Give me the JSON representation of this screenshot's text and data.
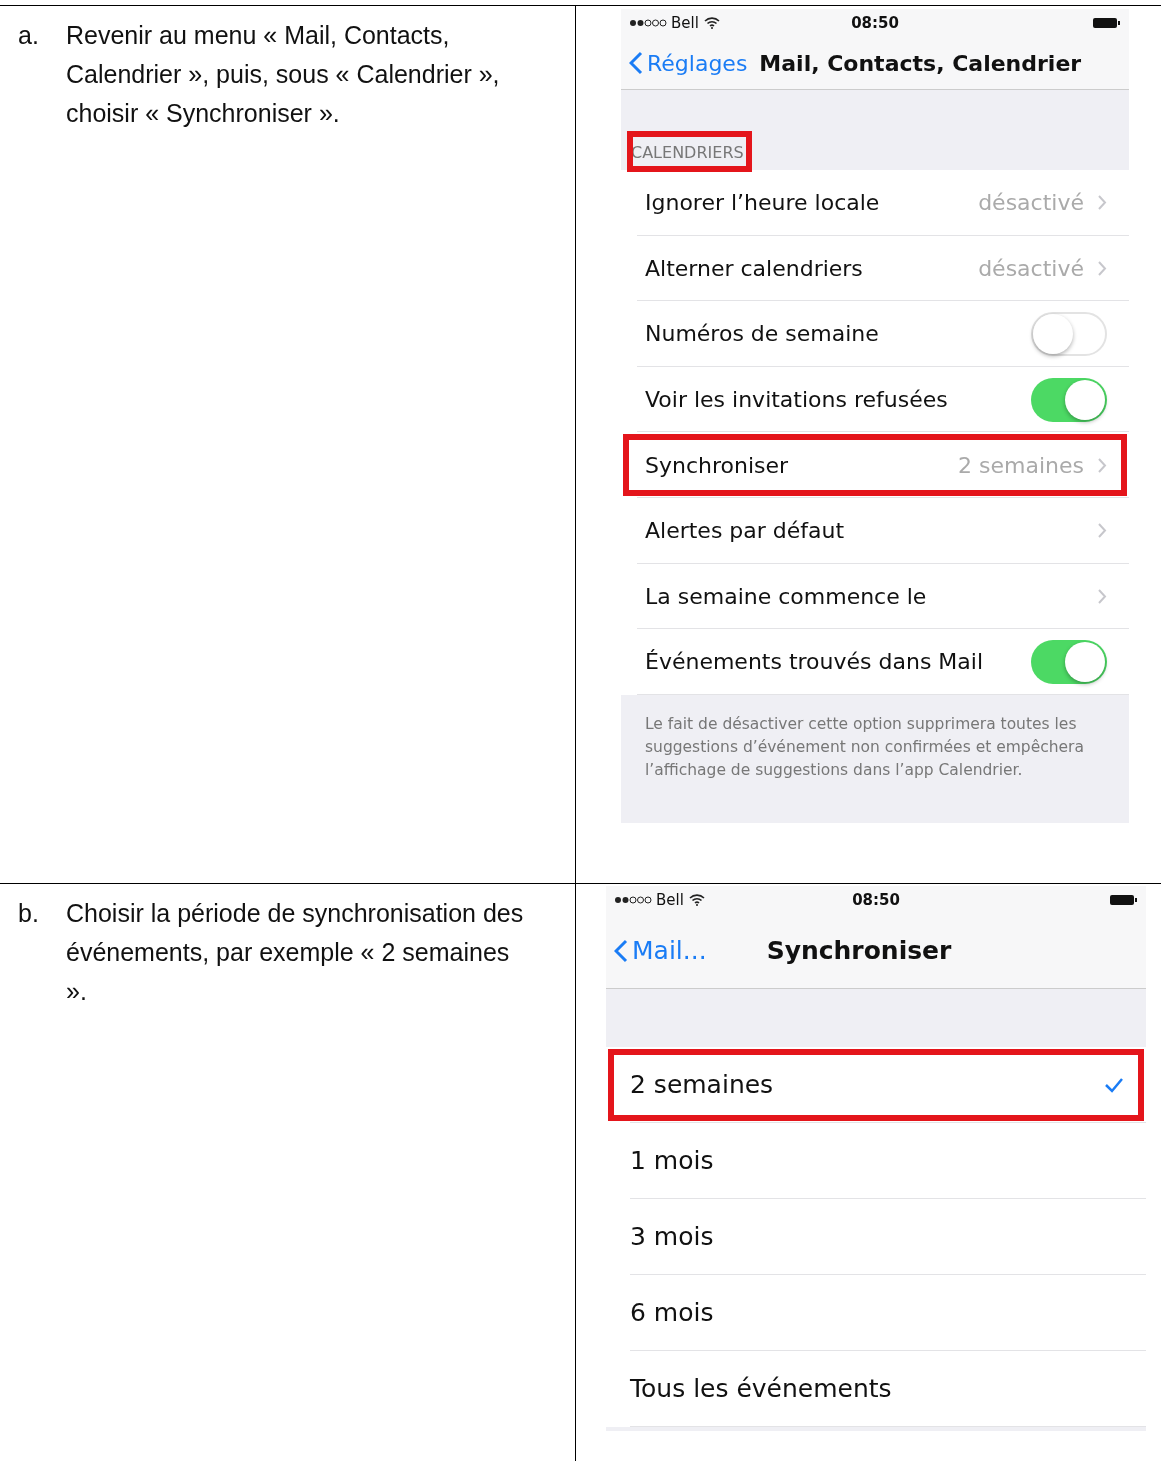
{
  "steps": [
    {
      "marker": "a.",
      "text": "Revenir au menu « Mail, Contacts, Calendrier », puis, sous « Calendrier », choisir « Synchroniser ».",
      "phone": {
        "carrier": "Bell",
        "time": "08:50",
        "back": "Réglages",
        "title": "Mail, Contacts, Calendrier",
        "section": {
          "label": "CALENDRIERS",
          "highlighted": true
        },
        "rows": [
          {
            "kind": "value",
            "label": "Ignorer l’heure locale",
            "value": "désactivé",
            "highlighted": false
          },
          {
            "kind": "value",
            "label": "Alterner calendriers",
            "value": "désactivé",
            "highlighted": false
          },
          {
            "kind": "toggle",
            "label": "Numéros de semaine",
            "on": false,
            "highlighted": false
          },
          {
            "kind": "toggle",
            "label": "Voir les invitations refusées",
            "on": true,
            "highlighted": false
          },
          {
            "kind": "value",
            "label": "Synchroniser",
            "value": "2 semaines",
            "highlighted": true
          },
          {
            "kind": "link",
            "label": "Alertes par défaut",
            "highlighted": false
          },
          {
            "kind": "link",
            "label": "La semaine commence le",
            "highlighted": false
          },
          {
            "kind": "toggle",
            "label": "Événements trouvés dans Mail",
            "on": true,
            "highlighted": false
          }
        ],
        "footer": "Le fait de désactiver cette option supprimera toutes les suggestions d’événement non confirmées et empêchera l’affichage de suggestions dans l’app Calendrier."
      }
    },
    {
      "marker": "b.",
      "text": "Choisir la période de synchronisation des événements, par exemple  « 2 semaines ».",
      "phone": {
        "carrier": "Bell",
        "time": "08:50",
        "back": "Mail...",
        "title": "Synchroniser",
        "rows": [
          {
            "kind": "choice",
            "label": "2 semaines",
            "selected": true,
            "highlighted": true
          },
          {
            "kind": "choice",
            "label": "1 mois",
            "selected": false,
            "highlighted": false
          },
          {
            "kind": "choice",
            "label": "3 mois",
            "selected": false,
            "highlighted": false
          },
          {
            "kind": "choice",
            "label": "6 mois",
            "selected": false,
            "highlighted": false
          },
          {
            "kind": "choice",
            "label": "Tous les événements",
            "selected": false,
            "highlighted": false
          }
        ]
      }
    }
  ]
}
